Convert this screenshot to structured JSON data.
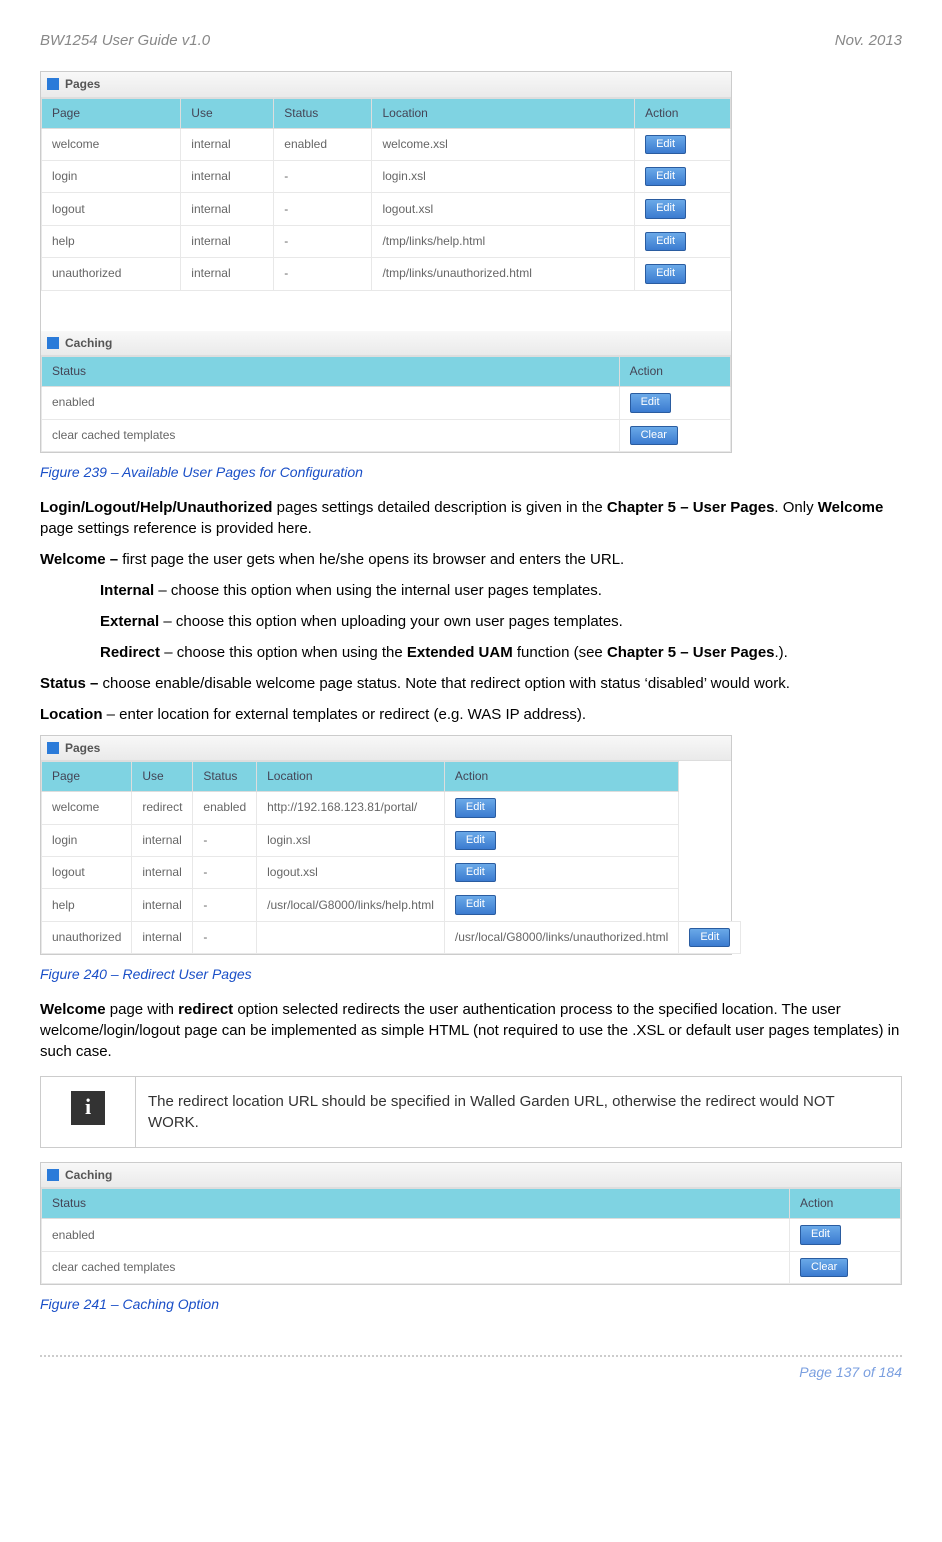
{
  "header": {
    "left": "BW1254 User Guide v1.0",
    "right": "Nov.  2013"
  },
  "pages1": {
    "section": "Pages",
    "cols": [
      "Page",
      "Use",
      "Status",
      "Location",
      "Action"
    ],
    "rows": [
      {
        "page": "welcome",
        "use": "internal",
        "status": "enabled",
        "location": "welcome.xsl",
        "action": "Edit"
      },
      {
        "page": "login",
        "use": "internal",
        "status": "-",
        "location": "login.xsl",
        "action": "Edit"
      },
      {
        "page": "logout",
        "use": "internal",
        "status": "-",
        "location": "logout.xsl",
        "action": "Edit"
      },
      {
        "page": "help",
        "use": "internal",
        "status": "-",
        "location": "/tmp/links/help.html",
        "action": "Edit"
      },
      {
        "page": "unauthorized",
        "use": "internal",
        "status": "-",
        "location": "/tmp/links/unauthorized.html",
        "action": "Edit"
      }
    ]
  },
  "caching1": {
    "section": "Caching",
    "cols": [
      "Status",
      "Action"
    ],
    "rows": [
      {
        "status": "enabled",
        "action": "Edit"
      },
      {
        "status": "clear cached templates",
        "action": "Clear"
      }
    ]
  },
  "caption1": "Figure 239 – Available User Pages for Configuration",
  "body1a_pre": "Login/Logout/Help/Unauthorized",
  "body1a_mid": " pages settings detailed description is given in the ",
  "body1a_bold2": "Chapter 5 – User Pages",
  "body1a_post": ". Only ",
  "body1a_bold3": "Welcome",
  "body1a_end": " page settings reference is provided here.",
  "body2_bold": "Welcome – ",
  "body2_rest": "first page the user gets when he/she opens its browser and enters the URL.",
  "opt_internal_b": "Internal",
  "opt_internal_t": " – choose this option when using the internal user pages templates.",
  "opt_external_b": "External",
  "opt_external_t": " – choose this option when uploading your own user pages templates.",
  "opt_redirect_b": "Redirect",
  "opt_redirect_t1": " – choose this option when using the ",
  "opt_redirect_b2": "Extended UAM",
  "opt_redirect_t2": " function (see ",
  "opt_redirect_b3": "Chapter 5 – User Pages",
  "opt_redirect_t3": ".).",
  "status_b": "Status – ",
  "status_t": "choose enable/disable welcome page status. Note that redirect option with status ‘disabled’ would work.",
  "location_b": "Location",
  "location_t": " – enter location for external templates or redirect (e.g. WAS IP address).",
  "pages2": {
    "section": "Pages",
    "cols": [
      "Page",
      "Use",
      "Status",
      "Location",
      "Action"
    ],
    "rows": [
      {
        "page": "welcome",
        "use": "redirect",
        "status": "enabled",
        "location": "http://192.168.123.81/portal/",
        "action": "Edit"
      },
      {
        "page": "login",
        "use": "internal",
        "status": "-",
        "location": "login.xsl",
        "action": "Edit"
      },
      {
        "page": "logout",
        "use": "internal",
        "status": "-",
        "location": "logout.xsl",
        "action": "Edit"
      },
      {
        "page": "help",
        "use": "internal",
        "status": "-",
        "location": "/usr/local/G8000/links/help.html",
        "action": "Edit"
      },
      {
        "page": "unauthorized",
        "use": "internal",
        "status": "-",
        "location": "/usr/local/G8000/links/unauthorized.html",
        "action": "Edit"
      }
    ]
  },
  "caption2": "Figure 240 – Redirect User Pages",
  "body3_b1": "Welcome",
  "body3_t1": " page with ",
  "body3_b2": "redirect",
  "body3_t2": " option selected redirects the user authentication process to the specified location. The user welcome/login/logout page can be implemented as simple HTML (not required to use the .XSL or default user pages templates) in such case.",
  "note_text": "The redirect location URL should be specified in Walled Garden URL, otherwise the redirect would NOT WORK.",
  "caching2": {
    "section": "Caching",
    "cols": [
      "Status",
      "Action"
    ],
    "rows": [
      {
        "status": "enabled",
        "action": "Edit"
      },
      {
        "status": "clear cached templates",
        "action": "Clear"
      }
    ]
  },
  "caption3": "Figure 241 – Caching Option",
  "footer": "Page 137 of 184"
}
